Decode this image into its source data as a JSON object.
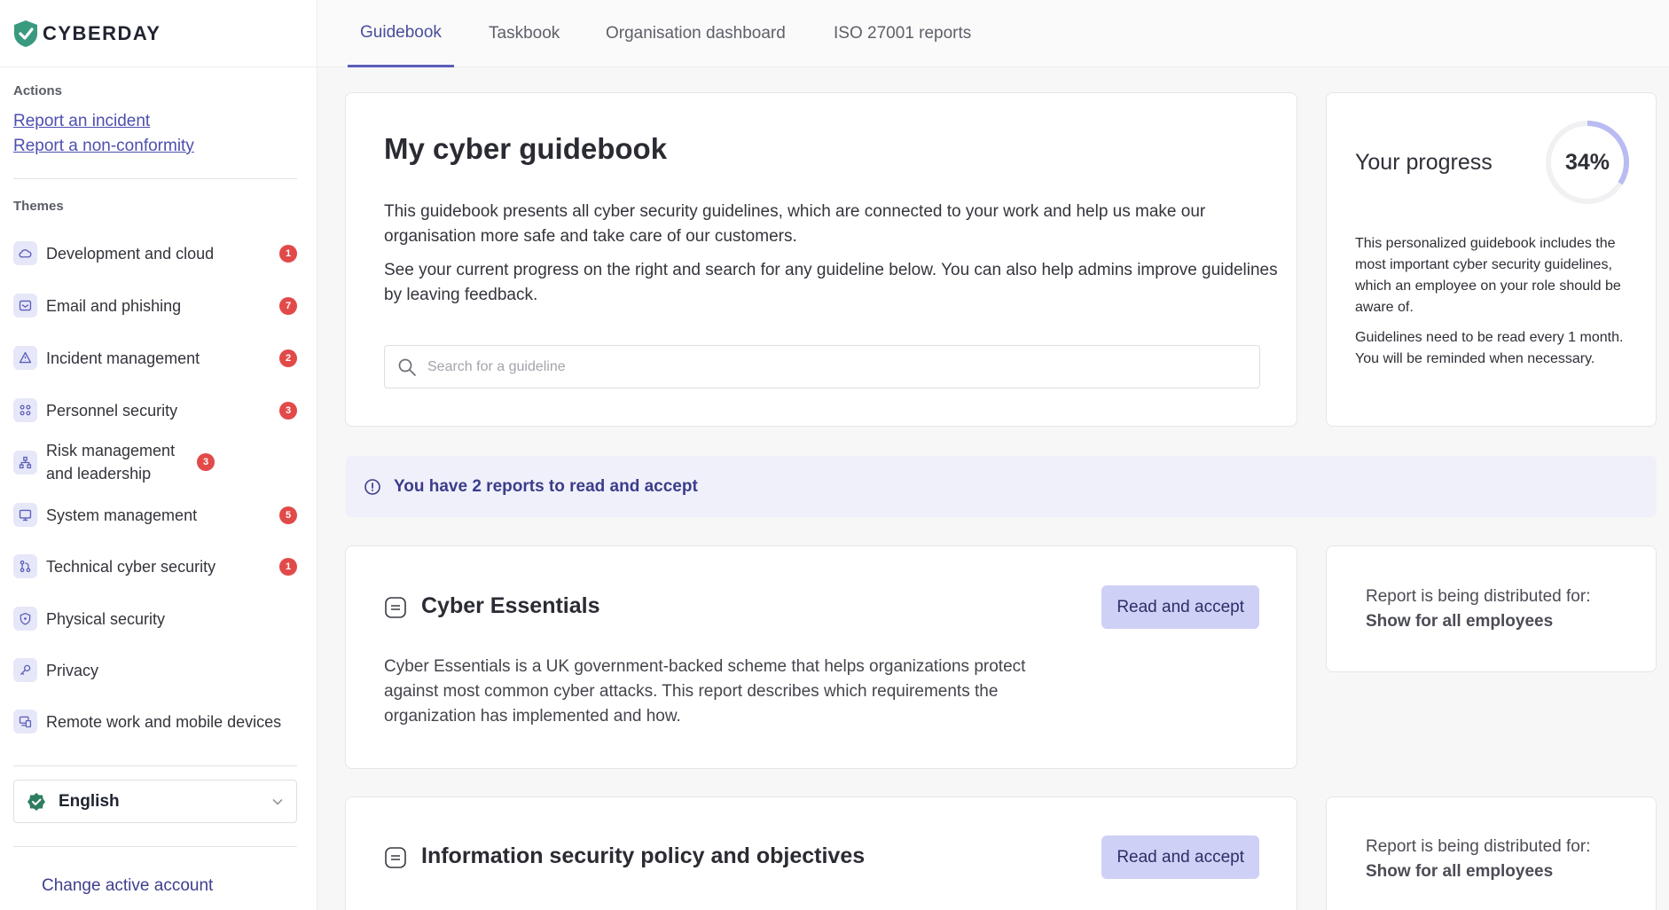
{
  "brand": {
    "name": "CYBERDAY"
  },
  "sidebar": {
    "actions_label": "Actions",
    "actions": [
      "Report an incident",
      "Report a non-conformity"
    ],
    "themes_label": "Themes",
    "themes": [
      {
        "label": "Development and cloud",
        "badge": "1",
        "icon": "cloud-icon"
      },
      {
        "label": "Email and phishing",
        "badge": "7",
        "icon": "mail-icon"
      },
      {
        "label": "Incident management",
        "badge": "2",
        "icon": "warning-icon"
      },
      {
        "label": "Personnel security",
        "badge": "3",
        "icon": "people-icon"
      },
      {
        "label": "Risk management and leadership",
        "badge": "3",
        "icon": "hierarchy-icon"
      },
      {
        "label": "System management",
        "badge": "5",
        "icon": "monitor-icon"
      },
      {
        "label": "Technical cyber security",
        "badge": "1",
        "icon": "git-icon"
      },
      {
        "label": "Physical security",
        "badge": "",
        "icon": "shield-icon"
      },
      {
        "label": "Privacy",
        "badge": "",
        "icon": "key-icon"
      },
      {
        "label": "Remote work and mobile devices",
        "badge": "",
        "icon": "devices-icon"
      }
    ],
    "language": "English",
    "change_account": "Change active account"
  },
  "nav": {
    "tabs": [
      "Guidebook",
      "Taskbook",
      "Organisation dashboard",
      "ISO 27001 reports"
    ],
    "active": "Guidebook"
  },
  "guidebook": {
    "title": "My cyber guidebook",
    "p1": "This guidebook presents all cyber security guidelines, which are connected to your work and help us make our organisation more safe and take care of our customers.",
    "p2": "See your current progress on the right and search for any guideline below. You can also help admins improve guidelines by leaving feedback.",
    "search_placeholder": "Search for a guideline"
  },
  "progress": {
    "title": "Your progress",
    "percent": 34,
    "percent_label": "34%",
    "p1": "This personalized guidebook includes the most important cyber security guidelines, which an employee on your role should be aware of.",
    "p2": "Guidelines need to be read every 1 month. You will be reminded when necessary."
  },
  "notice": {
    "text": "You have 2 reports to read and accept"
  },
  "reports": [
    {
      "title": "Cyber Essentials",
      "button": "Read and accept",
      "description": "Cyber Essentials is a UK government-backed scheme that helps organizations protect against most common cyber attacks. This report describes which requirements the organization has implemented and how.",
      "dist_label": "Report is being distributed for:",
      "dist_value": "Show for all employees"
    },
    {
      "title": "Information security policy and objectives",
      "button": "Read and accept",
      "description": "",
      "dist_label": "Report is being distributed for:",
      "dist_value": "Show for all employees"
    }
  ],
  "colors": {
    "accent": "#5b5eb8",
    "badge": "#e24a4a",
    "button": "#cfd0f6",
    "progress_ring": "#b9bbf2"
  }
}
